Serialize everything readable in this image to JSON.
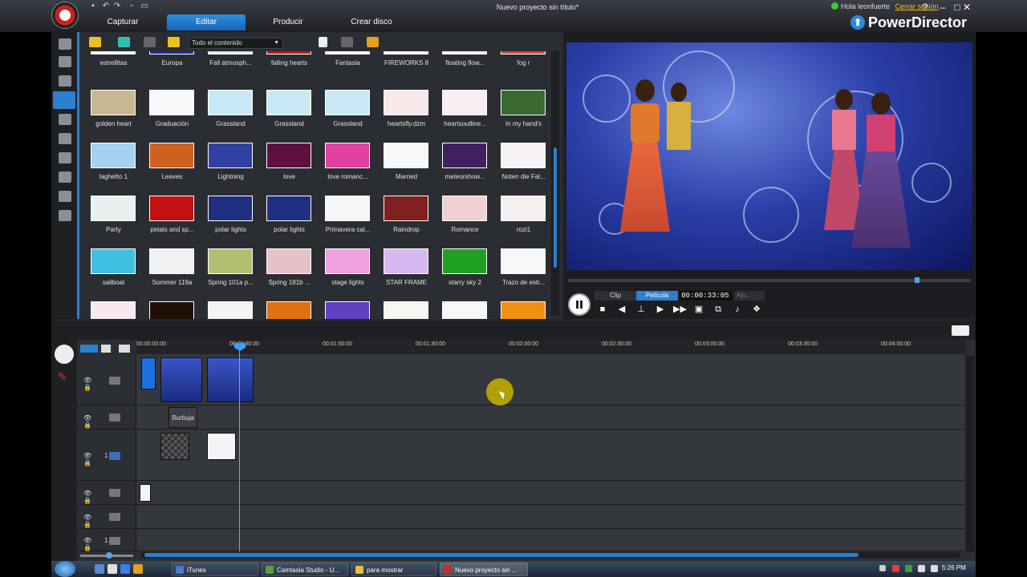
{
  "window": {
    "title": "Nuevo proyecto sin título*",
    "greeting": "Hola leonfuerte",
    "logout": "Cerrar sesión",
    "brand": "PowerDirector"
  },
  "main_tabs": [
    {
      "label": "Capturar",
      "active": false
    },
    {
      "label": "Editar",
      "active": true
    },
    {
      "label": "Producir",
      "active": false
    },
    {
      "label": "Crear disco",
      "active": false
    }
  ],
  "library": {
    "filter_selected": "Todo el contenido",
    "rows": [
      [
        "estrellitas",
        "Europa",
        "Fall atmosph...",
        "falling hearts",
        "Fantasia",
        "FIREWORKS 8",
        "floating flow...",
        "fog r"
      ],
      [
        "golden heart",
        "Graduación",
        "Grassland",
        "Grassland",
        "Grassland",
        "heartsfly.dzm",
        "heartsoutline...",
        "In my hand's"
      ],
      [
        "laghetto 1",
        "Leaves",
        "Lightning",
        "love",
        "love romanc...",
        "Married",
        "meteorshow...",
        "Noten die Fal..."
      ],
      [
        "Party",
        "petals and sp...",
        "polar lights",
        "polar lights",
        "Primavera cal...",
        "Raindrop",
        "Romance",
        "rozi1"
      ],
      [
        "sailboat",
        "Sommer 119a",
        "Spring 101a p...",
        "Spring 181b ...",
        "stage lights",
        "STAR FRAME",
        "starry sky 2",
        "Trazo de estr..."
      ],
      [
        "",
        "",
        "",
        "",
        "",
        "",
        "",
        ""
      ]
    ],
    "thumb_colors": [
      [
        "#f4f4f4",
        "#1a2aa0",
        "#e8e0f0",
        "#c01818",
        "#f6f6f6",
        "#f4f4ff",
        "#f8f0f4",
        "#e04040"
      ],
      [
        "#c8b890",
        "#f8f8f8",
        "#c8e8f8",
        "#c8e8f8",
        "#c8e8f8",
        "#f8e8e8",
        "#fbeef0",
        "#3a6a30"
      ],
      [
        "#a8d0f0",
        "#d06020",
        "#3040a0",
        "#601040",
        "#e040a0",
        "#f8f8f8",
        "#402060",
        "#f8f4f4"
      ],
      [
        "#e8f0f0",
        "#c01010",
        "#203080",
        "#203080",
        "#f6f6f6",
        "#802020",
        "#f0d0d0",
        "#f4f0f0"
      ],
      [
        "#40c0e0",
        "#f0f0f0",
        "#b0c070",
        "#e8c0c8",
        "#f0a0e0",
        "#d8b8f0",
        "#20a020",
        "#f8f8f8"
      ],
      [
        "#f8e8f0",
        "#201008",
        "#f4f4f4",
        "#e07010",
        "#6040c0",
        "#f4f8f0",
        "#f8f8f8",
        "#f09010"
      ]
    ]
  },
  "preview": {
    "mode_clip": "Clip",
    "mode_movie": "Película",
    "timecode": "00:00:33:05",
    "adjust": "Aju..."
  },
  "timeline": {
    "ticks": [
      "00:00:00:00",
      "00:00:30:00",
      "00:01:00:00",
      "00:01:30:00",
      "00:02:00:00",
      "00:02:30:00",
      "00:03:00:00",
      "00:03:30:00",
      "00:04:00:00"
    ],
    "effect_clip_label": "Burbuja",
    "pip_track_number": "1",
    "music_track_number": "1"
  },
  "taskbar": {
    "tasks": [
      {
        "label": "iTunes",
        "icon_color": "#4a7ad0"
      },
      {
        "label": "Camtasia Studio - U...",
        "icon_color": "#5aa040"
      },
      {
        "label": "para mostrar",
        "icon_color": "#e8c040"
      },
      {
        "label": "Nuevo proyecto sin ...",
        "icon_color": "#c03030"
      }
    ],
    "clock": "5:26 PM"
  },
  "colors": {
    "accent": "#2d7fd0",
    "playhead": "#22d0ee",
    "status_online": "#33cc33",
    "logout_link": "#f0c020"
  }
}
